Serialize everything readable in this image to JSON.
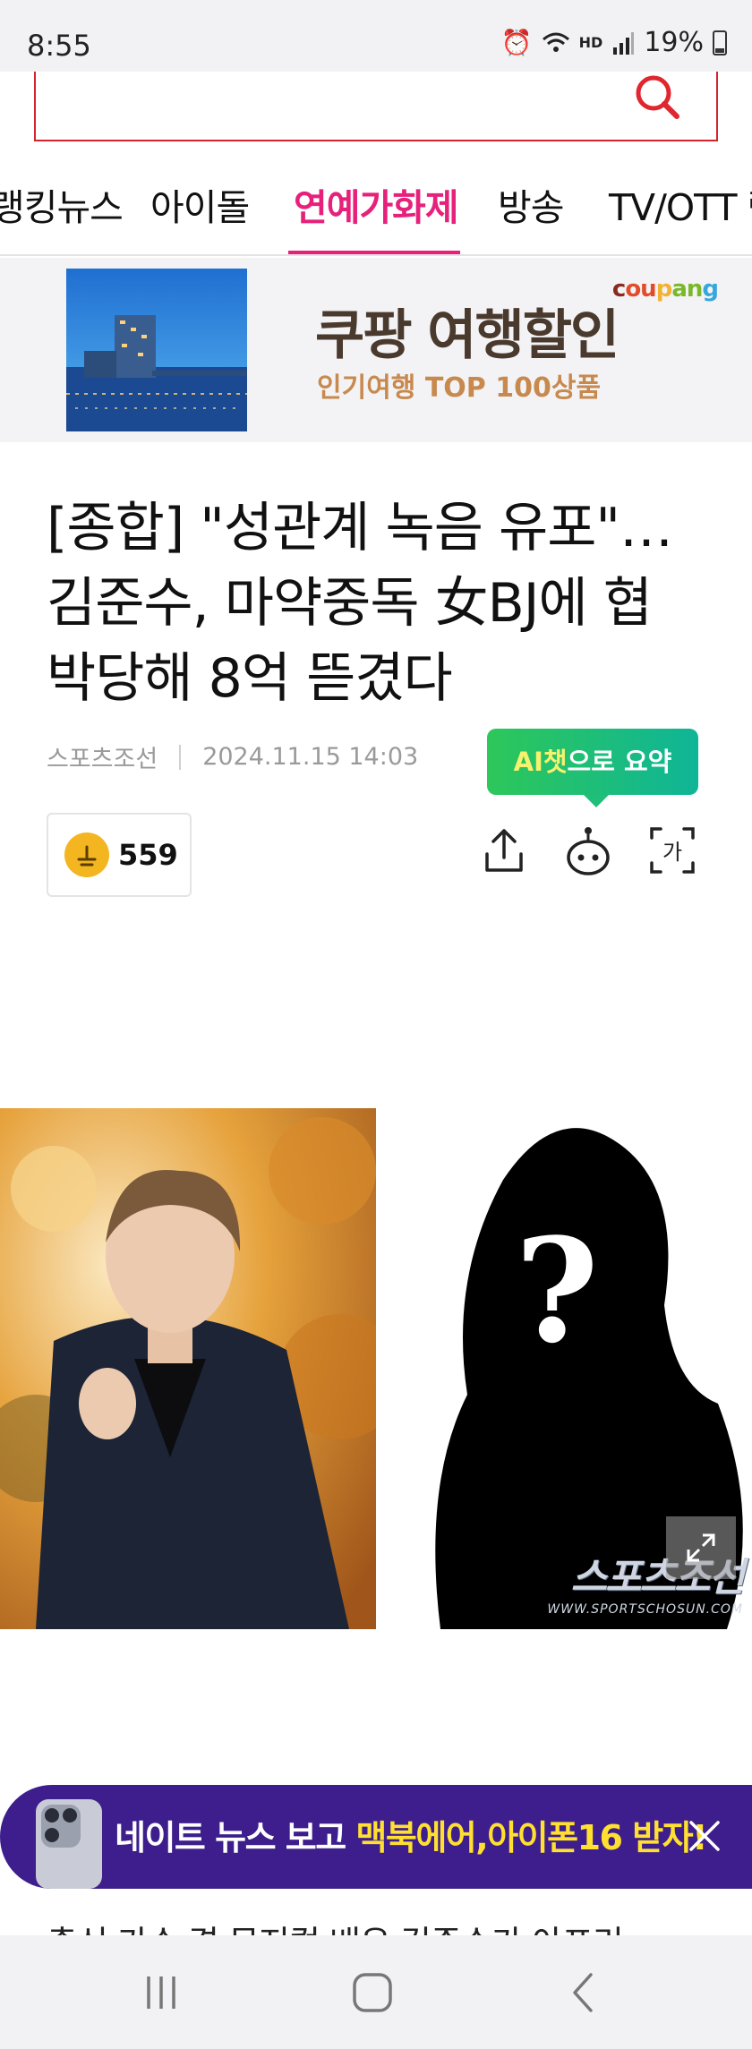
{
  "status_bar": {
    "time": "8:55",
    "icons": [
      "alarm-icon",
      "wifi-icon",
      "hd-voice-icon",
      "signal-icon"
    ],
    "hd_label": "HD",
    "battery": "19%"
  },
  "search": {
    "icon": "search-icon"
  },
  "nav": {
    "tabs": [
      {
        "label": "랭킹뉴스",
        "active": false
      },
      {
        "label": "아이돌",
        "active": false
      },
      {
        "label": "연예가화제",
        "active": true
      },
      {
        "label": "방송",
        "active": false
      },
      {
        "label": "TV/OTT 랑",
        "active": false
      }
    ],
    "accent_color": "#e7217b"
  },
  "ad": {
    "title": "쿠팡 여행할인",
    "subtitle": "인기여행 TOP 100상품",
    "logo_parts": [
      "c",
      "ou",
      "p",
      "an",
      "g"
    ]
  },
  "article": {
    "headline_lines": [
      "[종합] \"성관계 녹음 유포\"…",
      "김준수, 마약중독 女BJ에 협",
      "박당해 8억 뜯겼다"
    ],
    "source": "스포츠조선",
    "datetime": "2024.11.15 14:03",
    "like_count": "559",
    "like_icon": "like-face-icon",
    "ai_summary": {
      "hl": "AI챗",
      "rest": "으로 요약"
    },
    "actions": [
      "share-icon",
      "ai-chat-icon",
      "font-size-icon"
    ],
    "font_icon_text": "가"
  },
  "photo": {
    "watermark_big": "스포츠조선",
    "watermark_small": "WWW.SPORTSCHOSUN.COM",
    "question_mark": "?"
  },
  "promo": {
    "text_prefix": "네이트 뉴스 보고 ",
    "text_highlight": "맥북에어,아이폰16 받자!",
    "close_icon": "close-icon"
  },
  "article_peek": "출신 가수 겸 뮤지컬 배우 김준수가 아프리",
  "bottom_nav": [
    "recent-apps-icon",
    "home-icon",
    "back-icon"
  ],
  "colors": {
    "search_border": "#d3232f",
    "ai_green": "#2dc75a",
    "promo_bg": "#3d1e8c",
    "promo_highlight": "#ffe030"
  }
}
